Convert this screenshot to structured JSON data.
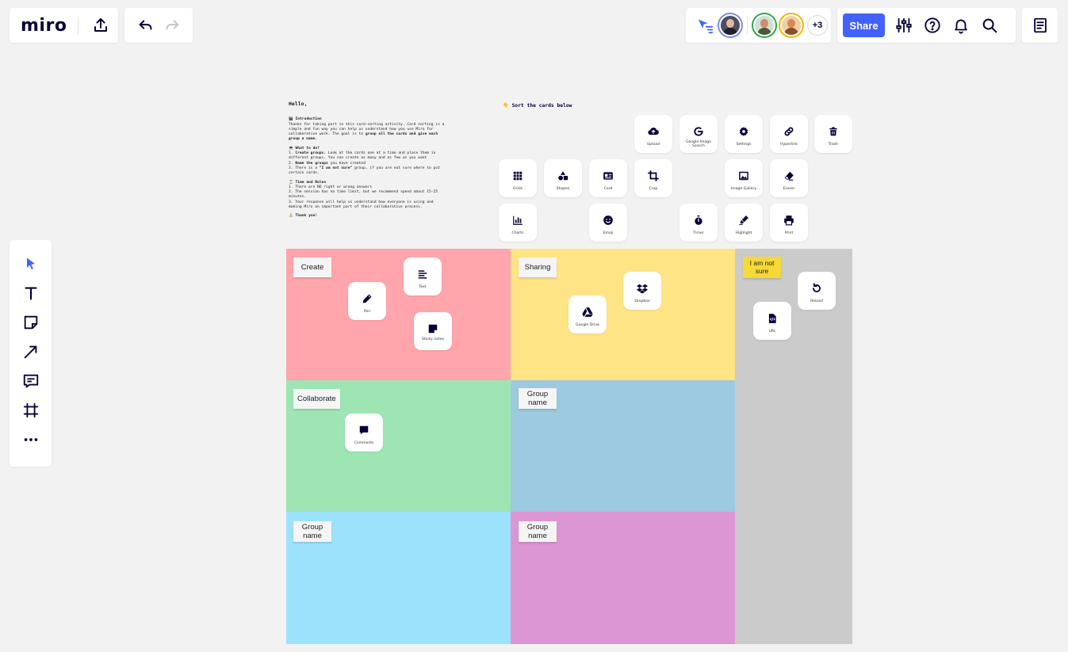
{
  "app": {
    "logo": "miro",
    "share_label": "Share",
    "more_collaborators": "+3"
  },
  "colors": {
    "accent": "#4262ff",
    "zone_create": "#ffa5ab",
    "zone_sharing": "#ffe486",
    "zone_collaborate": "#9de6b3",
    "zone_group2": "#9dc9e1",
    "zone_group3": "#9de2fc",
    "zone_group4": "#dc96d3",
    "zone_notsure": "#cbcbcb",
    "sticky_yellow": "#f6d838"
  },
  "instructions": {
    "greeting": "Hello,",
    "intro_heading": "🎬 Introduction",
    "intro_text_a": "Thanks for taking part in this card-sorting activity. Card sorting is a simple and fun way you can help us understand how you use Miro for collaborative work. The goal is to ",
    "intro_text_bold": "group all the cards and give each group a name.",
    "todo_heading": "💻 What to do?",
    "todo_1_bold": "Create groups.",
    "todo_1_text": " Look at the cards one at a time and place them in different groups. You can create as many and as few as you want",
    "todo_2_bold": "Name the groups",
    "todo_2_text": " you have created",
    "todo_3_a": "There is a ",
    "todo_3_bold": "\"I am not sure\"",
    "todo_3_b": " group, if you are not sure where to put certain cards.",
    "rules_heading": "⏳ Time and Rules",
    "rules_1": "There are NO right or wrong answers",
    "rules_2": "The session has no time limit, but we recommend spend about 15-25 minutes.",
    "rules_3": "Your response will help us understand how everyone is using and making Miro an important part of their collaborative process.",
    "thanks": "🙏 Thank you!"
  },
  "sort_title": "👇 Sort the cards below",
  "cards": {
    "upload": "Upload",
    "google_image_search": "Google Image Search",
    "settings": "Settings",
    "hyperlink": "Hyperlink",
    "trash": "Trash",
    "grids": "Grids",
    "shapes": "Shapes",
    "card": "Card",
    "crop": "Crop",
    "image_gallery": "Image Gallery",
    "eraser": "Eraser",
    "charts": "Charts",
    "emoji": "Emoji",
    "timer": "Timer",
    "highlight": "Highlight",
    "print": "Print",
    "text": "Text",
    "pen": "Pen",
    "sticky_notes": "Sticky notes",
    "dropbox": "Dropbox",
    "google_drive": "Google Drive",
    "reload": "Reload",
    "url": "URL",
    "comments": "Comments"
  },
  "groups": {
    "create": "Create",
    "sharing": "Sharing",
    "collaborate": "Collaborate",
    "group_name_2": "Group name",
    "group_name_3": "Group name",
    "group_name_4": "Group name",
    "not_sure": "I am not sure"
  }
}
